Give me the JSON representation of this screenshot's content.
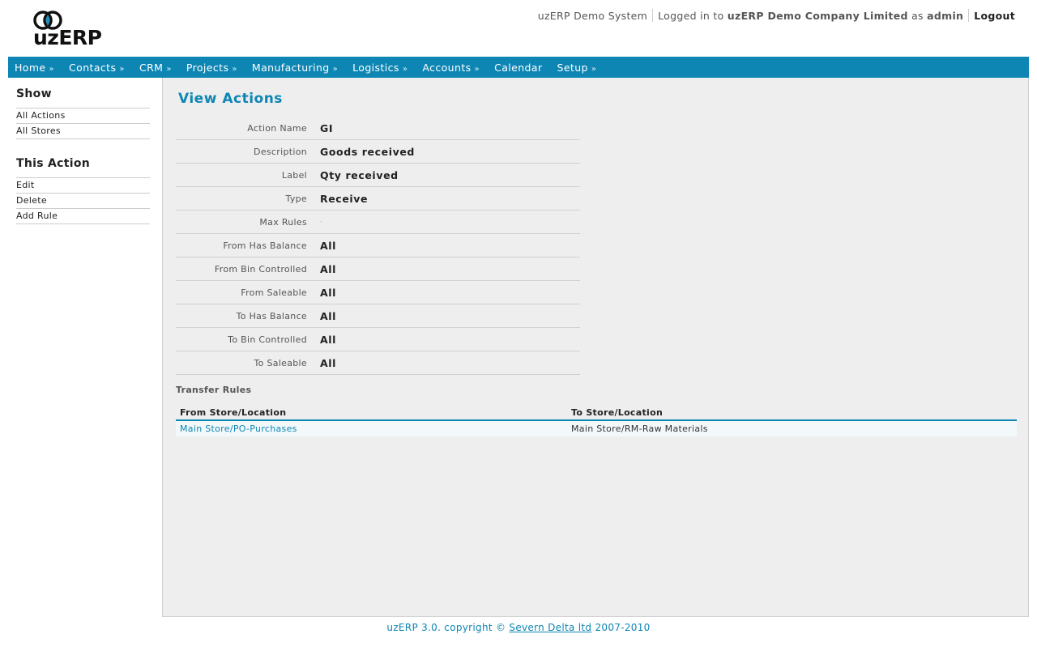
{
  "brand": {
    "logo_text": "uzERP"
  },
  "topbar": {
    "system_name": "uzERP Demo System",
    "logged_in_prefix": "Logged in to",
    "company": "uzERP Demo Company Limited",
    "as_text": "as",
    "user": "admin",
    "logout": "Logout"
  },
  "nav": {
    "items": [
      {
        "label": "Home",
        "arrow": "»"
      },
      {
        "label": "Contacts",
        "arrow": "»"
      },
      {
        "label": "CRM",
        "arrow": "»"
      },
      {
        "label": "Projects",
        "arrow": "»"
      },
      {
        "label": "Manufacturing",
        "arrow": "»"
      },
      {
        "label": "Logistics",
        "arrow": "»"
      },
      {
        "label": "Accounts",
        "arrow": "»"
      },
      {
        "label": "Calendar",
        "arrow": ""
      },
      {
        "label": "Setup",
        "arrow": "»"
      }
    ]
  },
  "sidebar": {
    "show_heading": "Show",
    "show_items": [
      "All Actions",
      "All Stores"
    ],
    "action_heading": "This Action",
    "action_items": [
      "Edit",
      "Delete",
      "Add Rule"
    ]
  },
  "main": {
    "title": "View Actions",
    "fields": [
      {
        "label": "Action Name",
        "value": "GI"
      },
      {
        "label": "Description",
        "value": "Goods received"
      },
      {
        "label": "Label",
        "value": "Qty received"
      },
      {
        "label": "Type",
        "value": "Receive"
      },
      {
        "label": "Max Rules",
        "value": "-"
      },
      {
        "label": "From Has Balance",
        "value": "All"
      },
      {
        "label": "From Bin Controlled",
        "value": "All"
      },
      {
        "label": "From Saleable",
        "value": "All"
      },
      {
        "label": "To Has Balance",
        "value": "All"
      },
      {
        "label": "To Bin Controlled",
        "value": "All"
      },
      {
        "label": "To Saleable",
        "value": "All"
      }
    ],
    "rules_title": "Transfer Rules",
    "rules_headers": [
      "From Store/Location",
      "To Store/Location"
    ],
    "rules_rows": [
      {
        "from": "Main Store/PO-Purchases",
        "to": "Main Store/RM-Raw Materials"
      }
    ]
  },
  "footer": {
    "prefix": "uzERP 3.0. copyright ©",
    "link": "Severn Delta ltd",
    "suffix": "2007-2010"
  },
  "colors": {
    "accent": "#0d86b4",
    "panel": "#eeeeee"
  }
}
